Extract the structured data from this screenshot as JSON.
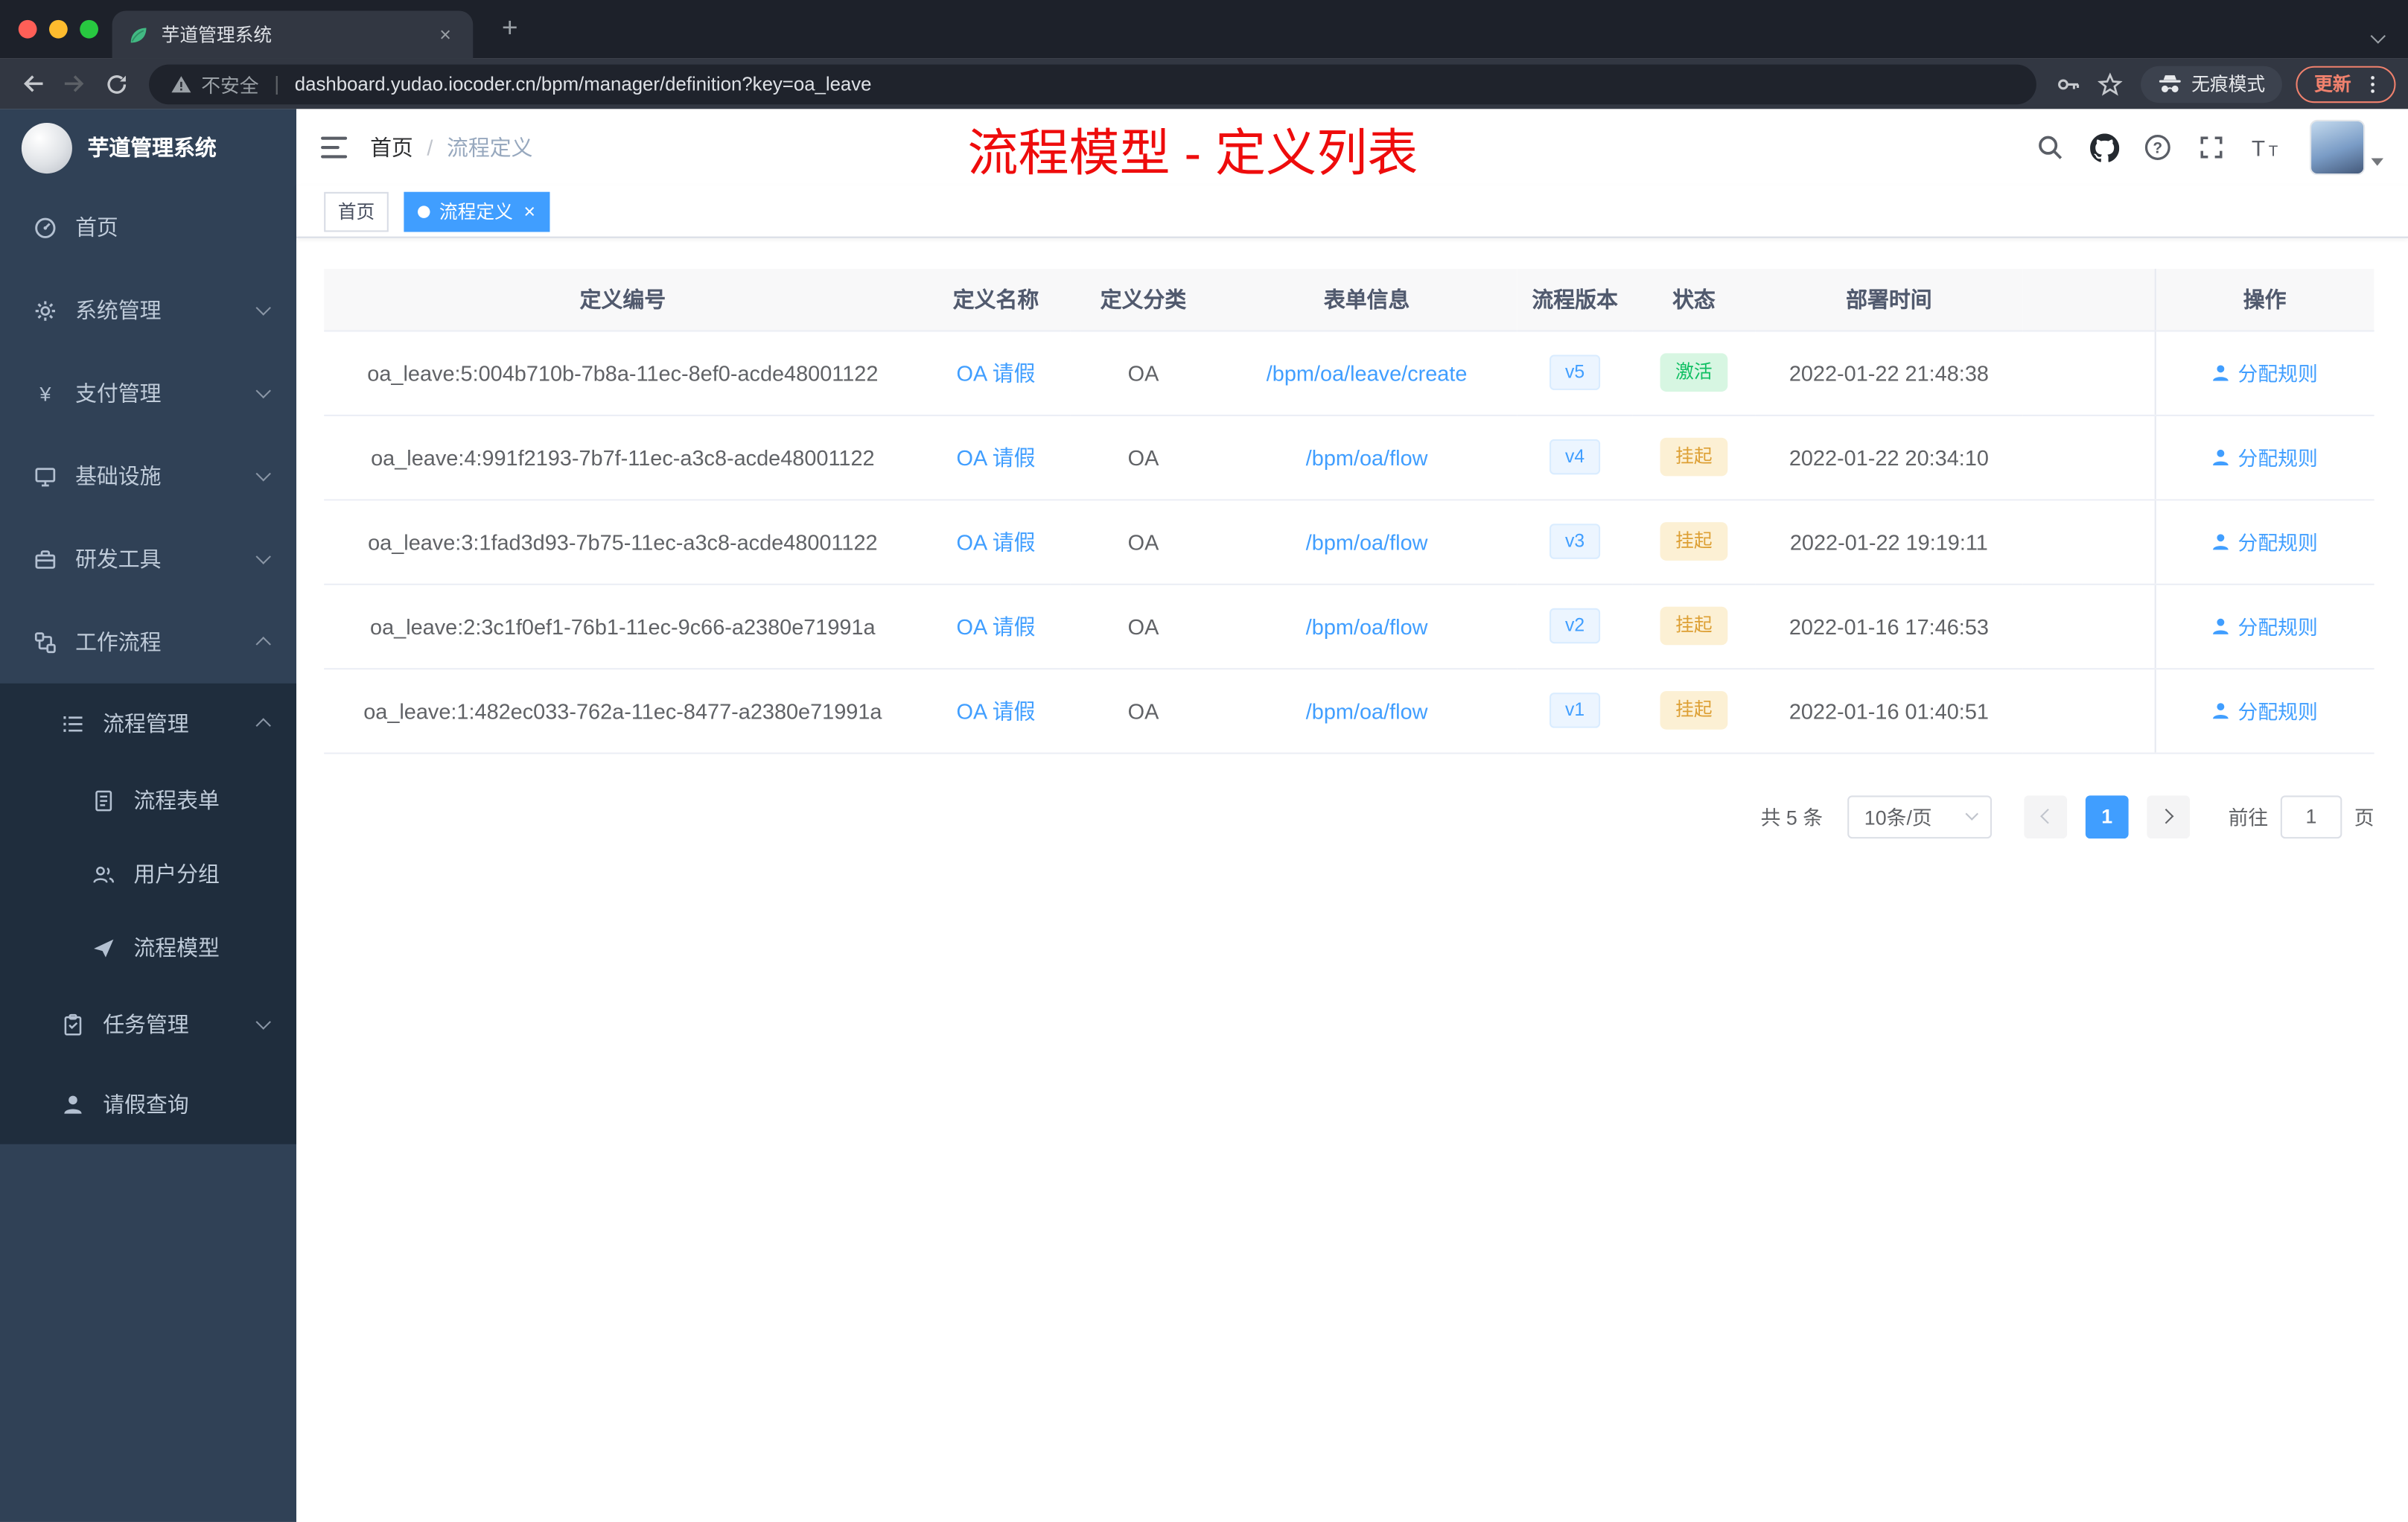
{
  "browser": {
    "tab_title": "芋道管理系统",
    "security_label": "不安全",
    "url": "dashboard.yudao.iocoder.cn/bpm/manager/definition?key=oa_leave",
    "incognito_label": "无痕模式",
    "update_label": "更新"
  },
  "sidebar": {
    "logo_title": "芋道管理系统",
    "items": [
      {
        "label": "首页"
      },
      {
        "label": "系统管理"
      },
      {
        "label": "支付管理"
      },
      {
        "label": "基础设施"
      },
      {
        "label": "研发工具"
      },
      {
        "label": "工作流程"
      },
      {
        "label": "流程管理"
      },
      {
        "label": "流程表单"
      },
      {
        "label": "用户分组"
      },
      {
        "label": "流程模型"
      },
      {
        "label": "任务管理"
      },
      {
        "label": "请假查询"
      }
    ]
  },
  "header": {
    "breadcrumb_home": "首页",
    "breadcrumb_current": "流程定义",
    "annotation": "流程模型 - 定义列表"
  },
  "tags": {
    "home": "首页",
    "active": "流程定义"
  },
  "table": {
    "columns": [
      "定义编号",
      "定义名称",
      "定义分类",
      "表单信息",
      "流程版本",
      "状态",
      "部署时间",
      "操作"
    ],
    "action_label": "分配规则",
    "rows": [
      {
        "id": "oa_leave:5:004b710b-7b8a-11ec-8ef0-acde48001122",
        "name": "OA 请假",
        "category": "OA",
        "form": "/bpm/oa/leave/create",
        "version": "v5",
        "status": "激活",
        "time": "2022-01-22 21:48:38"
      },
      {
        "id": "oa_leave:4:991f2193-7b7f-11ec-a3c8-acde48001122",
        "name": "OA 请假",
        "category": "OA",
        "form": "/bpm/oa/flow",
        "version": "v4",
        "status": "挂起",
        "time": "2022-01-22 20:34:10"
      },
      {
        "id": "oa_leave:3:1fad3d93-7b75-11ec-a3c8-acde48001122",
        "name": "OA 请假",
        "category": "OA",
        "form": "/bpm/oa/flow",
        "version": "v3",
        "status": "挂起",
        "time": "2022-01-22 19:19:11"
      },
      {
        "id": "oa_leave:2:3c1f0ef1-76b1-11ec-9c66-a2380e71991a",
        "name": "OA 请假",
        "category": "OA",
        "form": "/bpm/oa/flow",
        "version": "v2",
        "status": "挂起",
        "time": "2022-01-16 17:46:53"
      },
      {
        "id": "oa_leave:1:482ec033-762a-11ec-8477-a2380e71991a",
        "name": "OA 请假",
        "category": "OA",
        "form": "/bpm/oa/flow",
        "version": "v1",
        "status": "挂起",
        "time": "2022-01-16 01:40:51"
      }
    ]
  },
  "pagination": {
    "total": "共 5 条",
    "page_size": "10条/页",
    "current_page": "1",
    "goto_label": "前往",
    "goto_value": "1",
    "unit_label": "页"
  },
  "colors": {
    "accent": "#409eff",
    "sidebar_bg": "#304156",
    "sidebar_sub_bg": "#1f2d3d",
    "success": "#0fbf62",
    "warning": "#dd9f33",
    "annotation_red": "#ee0c0c"
  }
}
